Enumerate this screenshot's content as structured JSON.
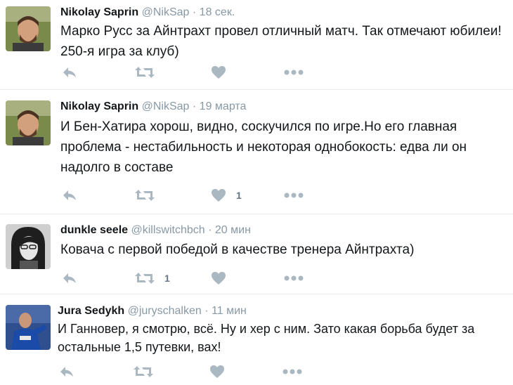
{
  "tweets": [
    {
      "name": "Nikolay Saprin",
      "handle": "@NikSap",
      "dot": "·",
      "time": "18 сек.",
      "text": "Марко Русс за Айнтрахт провел отличный матч. Так отмечают юбилеи! 250-я игра за клуб)",
      "replies": "",
      "retweets": "",
      "likes": ""
    },
    {
      "name": "Nikolay Saprin",
      "handle": "@NikSap",
      "dot": "·",
      "time": "19 марта",
      "text": "И Бен-Хатира хорош, видно, соскучился по игре.Но его главная проблема - нестабильность и некоторая однобокость: едва ли он надолго в составе",
      "replies": "",
      "retweets": "",
      "likes": "1"
    },
    {
      "name": "dunkle seele",
      "handle": "@killswitchbch",
      "dot": "·",
      "time": "20 мин",
      "text": "Ковача с первой победой в качестве тренера Айнтрахта)",
      "replies": "",
      "retweets": "1",
      "likes": ""
    },
    {
      "name": "Jura Sedykh",
      "handle": "@juryschalken",
      "dot": "·",
      "time": "11 мин",
      "text": "И Ганновер, я смотрю, всё. Ну и хер с ним. Зато какая борьба будет за остальные 1,5 путевки, вах!",
      "replies": "",
      "retweets": "",
      "likes": ""
    }
  ],
  "colors": {
    "icon": "#aab8c2",
    "name": "#14171a",
    "meta": "#8899a6",
    "divider": "#e6ecf0"
  },
  "icons": [
    "reply-icon",
    "retweet-icon",
    "like-icon",
    "more-icon"
  ]
}
